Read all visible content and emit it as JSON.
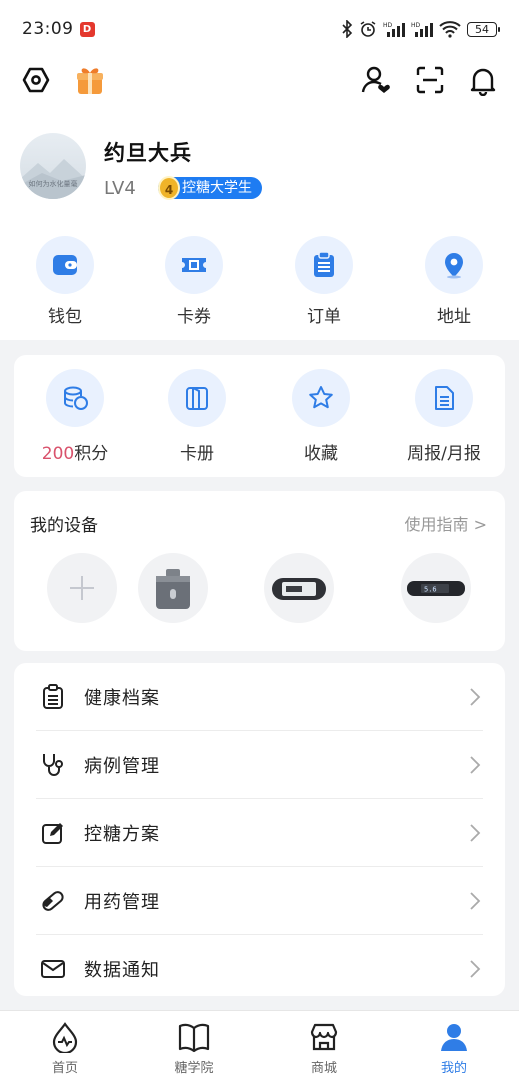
{
  "status_bar": {
    "time": "23:09",
    "app_badge": "D",
    "battery": "54"
  },
  "profile": {
    "name": "约旦大兵",
    "level": "LV4",
    "badge_number": "4",
    "badge_text": "控糖大学生",
    "avatar_caption": "如何为水化量毫"
  },
  "quick_actions": [
    {
      "label": "钱包",
      "icon": "wallet-icon"
    },
    {
      "label": "卡券",
      "icon": "coupon-icon"
    },
    {
      "label": "订单",
      "icon": "order-clipboard-icon"
    },
    {
      "label": "地址",
      "icon": "location-pin-icon"
    }
  ],
  "services": [
    {
      "number": "200",
      "label": "积分",
      "icon": "points-coins-icon"
    },
    {
      "label": "卡册",
      "icon": "card-album-icon"
    },
    {
      "label": "收藏",
      "icon": "star-icon"
    },
    {
      "label": "周报/月报",
      "icon": "report-document-icon"
    }
  ],
  "devices": {
    "title": "我的设备",
    "guide": "使用指南 >"
  },
  "menu": [
    {
      "label": "健康档案",
      "icon": "health-record-icon"
    },
    {
      "label": "病例管理",
      "icon": "stethoscope-icon"
    },
    {
      "label": "控糖方案",
      "icon": "edit-plan-icon"
    },
    {
      "label": "用药管理",
      "icon": "pill-icon"
    },
    {
      "label": "数据通知",
      "icon": "envelope-icon"
    }
  ],
  "tabs": [
    {
      "label": "首页",
      "icon": "home-drop-icon"
    },
    {
      "label": "糖学院",
      "icon": "book-icon"
    },
    {
      "label": "商城",
      "icon": "store-icon"
    },
    {
      "label": "我的",
      "icon": "profile-person-icon"
    }
  ],
  "colors": {
    "accent": "#2f7de6",
    "points_number": "#d9526c",
    "icon_bg": "#e9f1fe",
    "page_bg": "#f2f3f5"
  }
}
